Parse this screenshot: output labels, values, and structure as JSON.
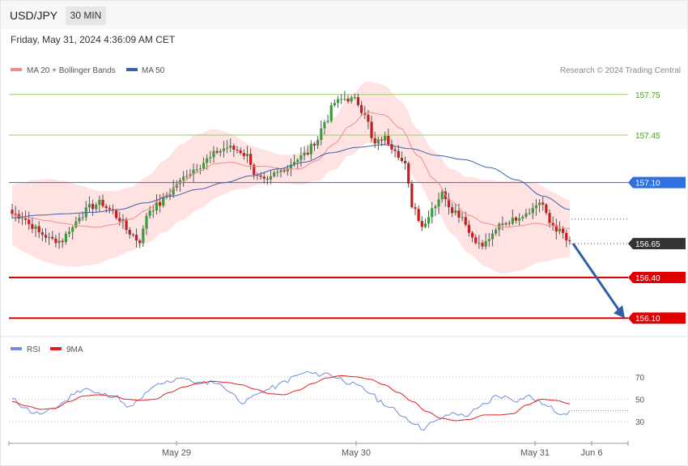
{
  "header": {
    "symbol": "USD/JPY",
    "timeframe": "30 MIN",
    "datetime": "Friday, May 31, 2024 4:36:09 AM CET"
  },
  "legend": {
    "ma20": "MA 20 + Bollinger Bands",
    "ma50": "MA 50",
    "credit": "Research © 2024 Trading Central",
    "rsi": "RSI",
    "rsi_ma": "9MA"
  },
  "colors": {
    "up": "#3a9d3a",
    "down": "#c81d1d",
    "band": "#ffe3e3",
    "ma20": "#f08c8c",
    "ma50": "#3c5fa8",
    "resistance": "#9acd6e",
    "pivot": "#2f6fe0",
    "support": "#e00000",
    "last": "#333333",
    "arrow": "#2f5ea8",
    "rsi": "#6e8fdc",
    "rsi_ma": "#e02020"
  },
  "chart_data": [
    {
      "type": "candlestick",
      "title": "USD/JPY",
      "timeframe": "30 MIN",
      "ylim": [
        156.0,
        157.85
      ],
      "x_ticks": [
        "May 29",
        "May 30",
        "May 31",
        "Jun 6"
      ],
      "levels": [
        {
          "label": "157.75",
          "value": 157.75,
          "kind": "resistance"
        },
        {
          "label": "157.45",
          "value": 157.45,
          "kind": "resistance"
        },
        {
          "label": "157.10",
          "value": 157.1,
          "kind": "pivot"
        },
        {
          "label": "156.65",
          "value": 156.65,
          "kind": "last"
        },
        {
          "label": "156.40",
          "value": 156.4,
          "kind": "support"
        },
        {
          "label": "156.10",
          "value": 156.1,
          "kind": "support"
        }
      ],
      "price_path": [
        156.87,
        156.85,
        156.78,
        156.72,
        156.68,
        156.67,
        156.76,
        156.86,
        156.92,
        156.95,
        156.9,
        156.83,
        156.73,
        156.67,
        156.9,
        156.94,
        157.02,
        157.1,
        157.17,
        157.22,
        157.27,
        157.33,
        157.36,
        157.34,
        157.3,
        157.14,
        157.1,
        157.17,
        157.21,
        157.27,
        157.31,
        157.4,
        157.55,
        157.69,
        157.72,
        157.71,
        157.62,
        157.38,
        157.43,
        157.36,
        157.25,
        156.92,
        156.78,
        156.92,
        157.02,
        156.9,
        156.85,
        156.7,
        156.63,
        156.7,
        156.8,
        156.82,
        156.86,
        156.9,
        156.96,
        156.8,
        156.74,
        156.65
      ],
      "ma20": [
        156.86,
        156.84,
        156.82,
        156.8,
        156.78,
        156.77,
        156.79,
        156.83,
        156.9,
        157.0,
        157.1,
        157.18,
        157.24,
        157.25,
        157.22,
        157.22,
        157.2,
        157.2,
        157.26,
        157.38,
        157.52,
        157.62,
        157.6,
        157.5,
        157.3,
        157.12,
        156.96,
        156.86,
        156.8,
        156.77,
        156.78,
        156.8,
        156.78,
        156.76
      ],
      "ma50": [
        156.84,
        156.86,
        156.87,
        156.88,
        156.9,
        156.95,
        157.0,
        157.05,
        157.1,
        157.15,
        157.2,
        157.25,
        157.32,
        157.36,
        157.38,
        157.35,
        157.3,
        157.27,
        157.21,
        157.12,
        157.0,
        156.9
      ],
      "forecast": {
        "from": 156.65,
        "to": 156.1
      }
    },
    {
      "type": "line",
      "title": "RSI",
      "ylim": [
        15,
        85
      ],
      "y_ticks": [
        70,
        50,
        30
      ],
      "series": [
        {
          "name": "RSI",
          "values": [
            50,
            44,
            38,
            37,
            42,
            48,
            56,
            60,
            55,
            54,
            52,
            42,
            48,
            58,
            63,
            66,
            70,
            66,
            64,
            66,
            62,
            54,
            47,
            53,
            58,
            61,
            66,
            71,
            74,
            72,
            73,
            69,
            65,
            61,
            56,
            48,
            42,
            36,
            30,
            24,
            29,
            34,
            38,
            35,
            40,
            46,
            53,
            52,
            49,
            53,
            48,
            43,
            38,
            38
          ]
        },
        {
          "name": "9MA",
          "values": [
            48,
            44,
            41,
            42,
            48,
            53,
            54,
            53,
            50,
            49,
            50,
            56,
            61,
            64,
            66,
            65,
            63,
            59,
            55,
            54,
            58,
            64,
            69,
            71,
            70,
            68,
            63,
            56,
            48,
            39,
            33,
            31,
            32,
            36,
            36,
            37,
            45,
            50,
            49,
            46
          ]
        }
      ]
    }
  ]
}
